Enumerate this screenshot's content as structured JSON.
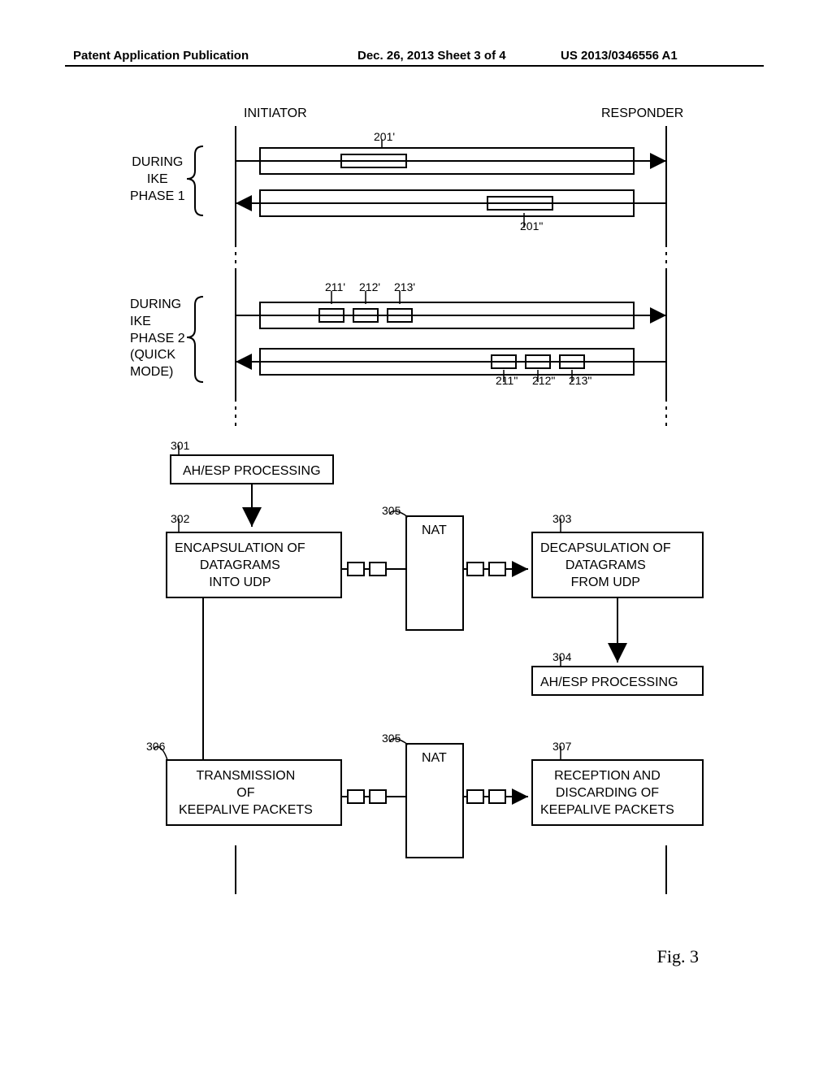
{
  "header": {
    "left": "Patent Application Publication",
    "mid": "Dec. 26, 2013  Sheet 3 of 4",
    "right": "US 2013/0346556 A1"
  },
  "actors": {
    "initiator": "INITIATOR",
    "responder": "RESPONDER"
  },
  "phase1": {
    "label": "DURING\nIKE\nPHASE 1",
    "ref_top": "201'",
    "ref_bottom": "201\""
  },
  "phase2": {
    "label": "DURING\nIKE\nPHASE 2\n(QUICK\nMODE)",
    "refs_top": {
      "a": "211'",
      "b": "212'",
      "c": "213'"
    },
    "refs_bottom": {
      "a": "211\"",
      "b": "212\"",
      "c": "213\""
    }
  },
  "boxes": {
    "b301": {
      "ref": "301",
      "text": "AH/ESP PROCESSING"
    },
    "b302": {
      "ref": "302",
      "text": "ENCAPSULATION OF\nDATAGRAMS\nINTO UDP"
    },
    "b303": {
      "ref": "303",
      "text": "DECAPSULATION OF\nDATAGRAMS\nFROM UDP"
    },
    "b304": {
      "ref": "304",
      "text": "AH/ESP PROCESSING"
    },
    "b305_top": {
      "ref": "305",
      "text": "NAT"
    },
    "b305_bot": {
      "ref": "305",
      "text": "NAT"
    },
    "b306": {
      "ref": "306",
      "text": "TRANSMISSION\nOF\nKEEPALIVE PACKETS"
    },
    "b307": {
      "ref": "307",
      "text": "RECEPTION AND\nDISCARDING OF\nKEEPALIVE PACKETS"
    }
  },
  "figure_caption": "Fig. 3"
}
